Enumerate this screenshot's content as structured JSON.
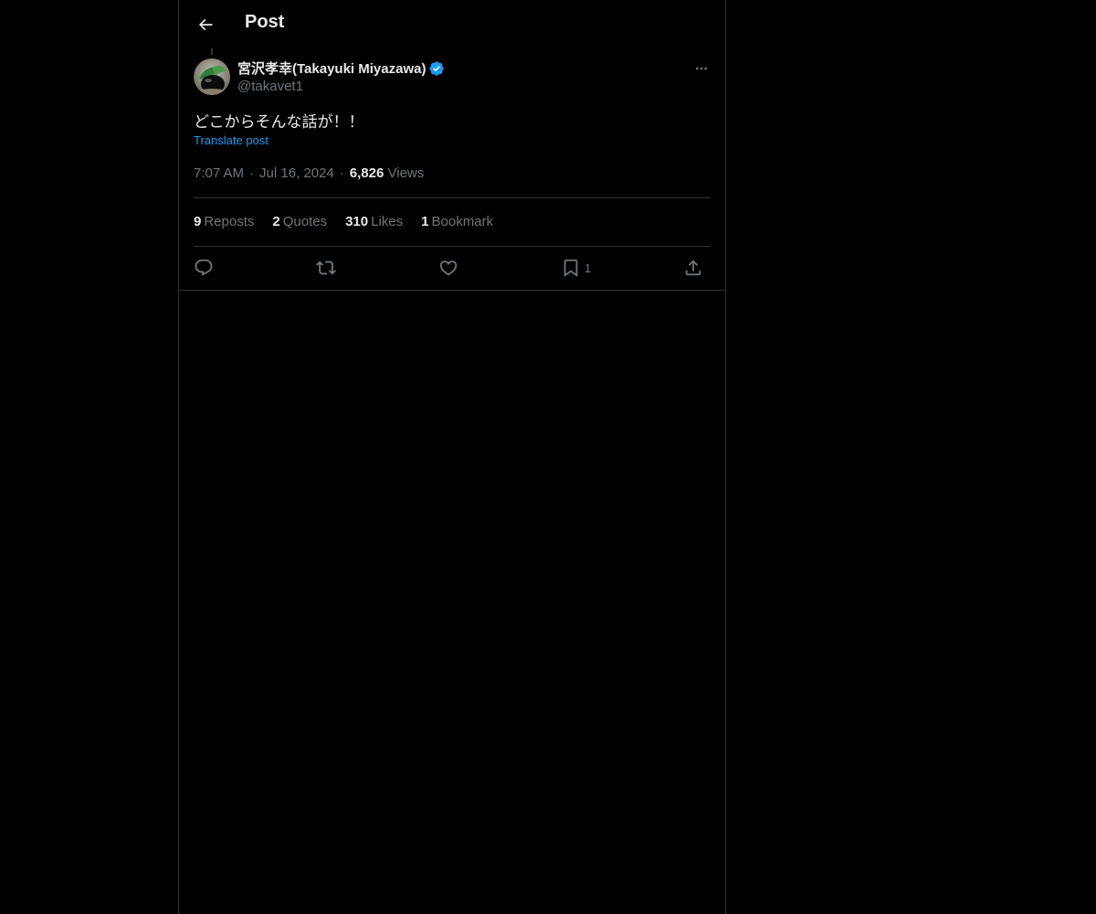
{
  "header": {
    "title": "Post",
    "back_icon": "arrow-left-icon"
  },
  "post": {
    "author_name": "宮沢孝幸(Takayuki Miyazawa)",
    "author_handle": "@takavet1",
    "verified": true,
    "text": "どこからそんな話が！！",
    "translate_label": "Translate post",
    "time": "7:07 AM",
    "date": "Jul 16, 2024",
    "views_count": "6,826",
    "views_label": "Views"
  },
  "stats": {
    "reposts_count": "9",
    "reposts_label": "Reposts",
    "quotes_count": "2",
    "quotes_label": "Quotes",
    "likes_count": "310",
    "likes_label": "Likes",
    "bookmarks_count": "1",
    "bookmarks_label": "Bookmark"
  },
  "actions": {
    "reply_icon": "reply-icon",
    "repost_icon": "repost-icon",
    "like_icon": "heart-icon",
    "bookmark_icon": "bookmark-icon",
    "bookmark_count": "1",
    "share_icon": "share-icon"
  },
  "colors": {
    "background": "#000000",
    "text_primary": "#e7e9ea",
    "text_secondary": "#71767b",
    "accent": "#1d9bf0",
    "border": "#2f3336"
  }
}
